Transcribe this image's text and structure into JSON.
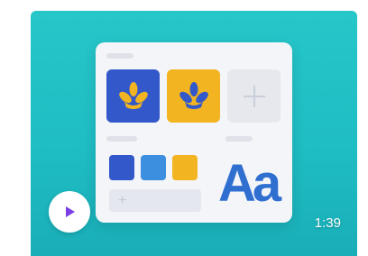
{
  "video_card": {
    "duration": "1:39",
    "play_icon": "play-icon",
    "colors": {
      "background": "#26c6c9",
      "primary_blue": "#3358c9",
      "accent_yellow": "#f2b521",
      "light_blue": "#3b8fde",
      "play_purple": "#7b3fe4"
    },
    "illustration": {
      "font_sample": "Aa",
      "add_symbol": "+",
      "tiles": [
        {
          "icon": "plant-logo-icon",
          "color": "#3358c9"
        },
        {
          "icon": "plant-logo-icon",
          "color": "#f2b521"
        },
        {
          "icon": "plus-icon",
          "color": "#e6e8ee"
        }
      ],
      "swatches": [
        "#3358c9",
        "#3b8fde",
        "#f2b521"
      ]
    }
  }
}
